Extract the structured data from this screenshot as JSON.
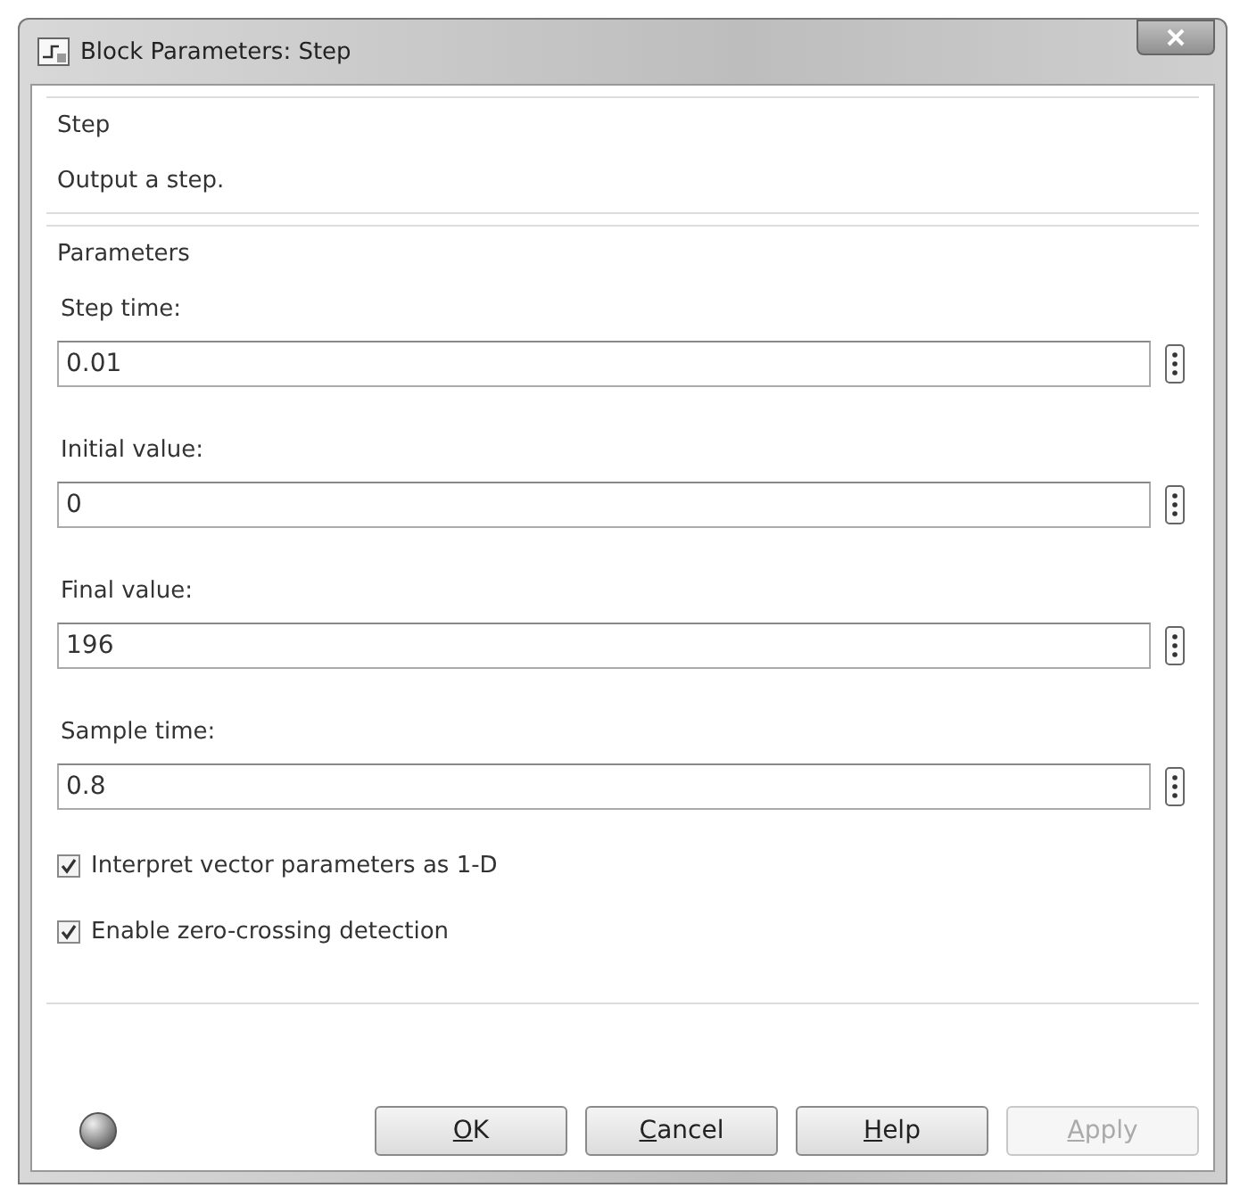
{
  "window": {
    "title": "Block Parameters: Step"
  },
  "description_group": {
    "title": "Step",
    "text": "Output a step."
  },
  "parameters_group": {
    "title": "Parameters",
    "fields": [
      {
        "label": "Step time:",
        "value": "0.01"
      },
      {
        "label": "Initial value:",
        "value": "0"
      },
      {
        "label": "Final value:",
        "value": "196"
      },
      {
        "label": "Sample time:",
        "value": "0.8"
      }
    ],
    "options": [
      {
        "label": "Interpret vector parameters as 1-D",
        "checked": true
      },
      {
        "label": "Enable zero-crossing detection",
        "checked": true
      }
    ]
  },
  "buttons": [
    {
      "label": "OK",
      "disabled": false
    },
    {
      "label": "Cancel",
      "disabled": false
    },
    {
      "label": "Help",
      "disabled": false
    },
    {
      "label": "Apply",
      "disabled": true
    }
  ]
}
